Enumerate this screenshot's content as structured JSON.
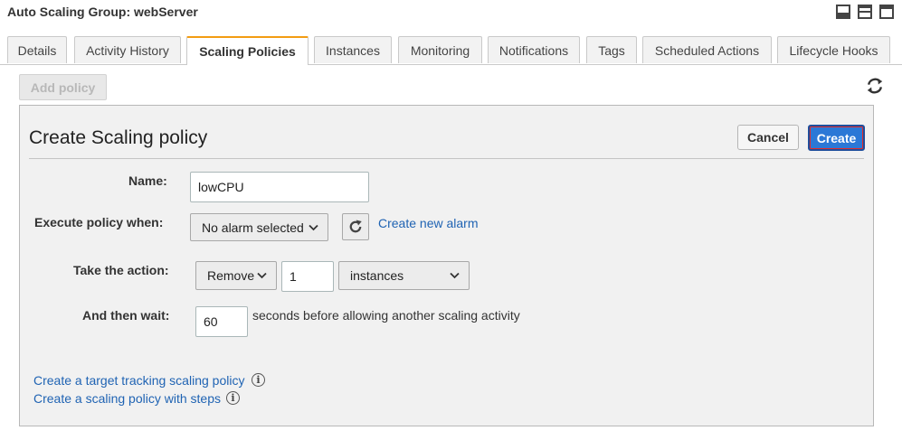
{
  "header": {
    "title": "Auto Scaling Group: webServer"
  },
  "tabs": [
    {
      "label": "Details"
    },
    {
      "label": "Activity History"
    },
    {
      "label": "Scaling Policies"
    },
    {
      "label": "Instances"
    },
    {
      "label": "Monitoring"
    },
    {
      "label": "Notifications"
    },
    {
      "label": "Tags"
    },
    {
      "label": "Scheduled Actions"
    },
    {
      "label": "Lifecycle Hooks"
    }
  ],
  "active_tab": "Scaling Policies",
  "toolbar": {
    "add_policy_label": "Add policy",
    "refresh_icon": "refresh-icon"
  },
  "form": {
    "title": "Create Scaling policy",
    "cancel_label": "Cancel",
    "create_label": "Create",
    "name_label": "Name:",
    "name_value": "lowCPU",
    "execute_label": "Execute policy when:",
    "alarm_select": "No alarm selected",
    "create_alarm_link": "Create new alarm",
    "action_label": "Take the action:",
    "action_select": "Remove",
    "action_amount": "1",
    "action_unit": "instances",
    "wait_label": "And then wait:",
    "wait_value": "60",
    "wait_suffix": "seconds before allowing another scaling activity",
    "target_tracking_link": "Create a target tracking scaling policy",
    "step_policy_link": "Create a scaling policy with steps",
    "info_glyph": "i"
  },
  "colors": {
    "active_tab_accent": "#f39c12",
    "primary_button": "#2b78d6",
    "link": "#1f63b3"
  }
}
